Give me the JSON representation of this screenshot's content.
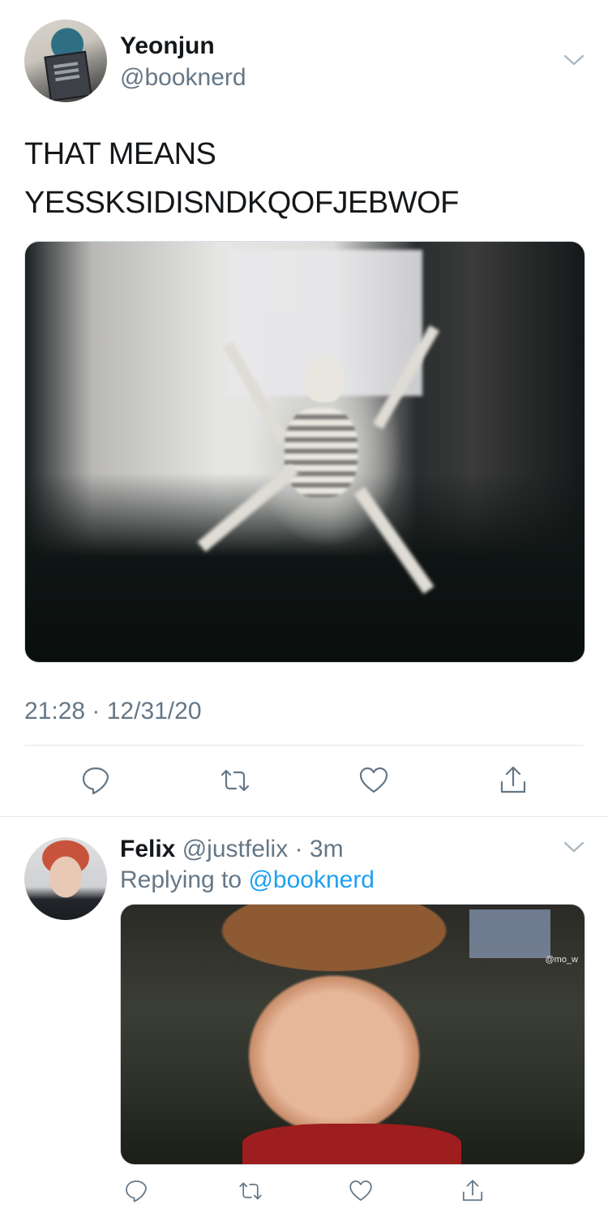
{
  "tweet": {
    "author_name": "Yeonjun",
    "author_handle": "@booknerd",
    "text_lines": [
      "THAT MEANS",
      "YESSKSIDISNDKQOFJEBWOF"
    ],
    "image_label": "skeleton-meme-image",
    "timestamp": "21:28 · 12/31/20"
  },
  "reply": {
    "author_name": "Felix",
    "author_handle": "@justfelix",
    "time_ago": "· 3m",
    "replying_prefix": "Replying to",
    "replying_to": "@booknerd",
    "image_watermark": "@mo_w"
  },
  "icons": {
    "reply": "reply-icon",
    "retweet": "retweet-icon",
    "like": "heart-icon",
    "share": "share-icon",
    "more": "chevron-down-icon"
  },
  "colors": {
    "text": "#14171a",
    "secondary": "#657786",
    "link": "#1da1f2",
    "divider": "#e1e8ed"
  }
}
